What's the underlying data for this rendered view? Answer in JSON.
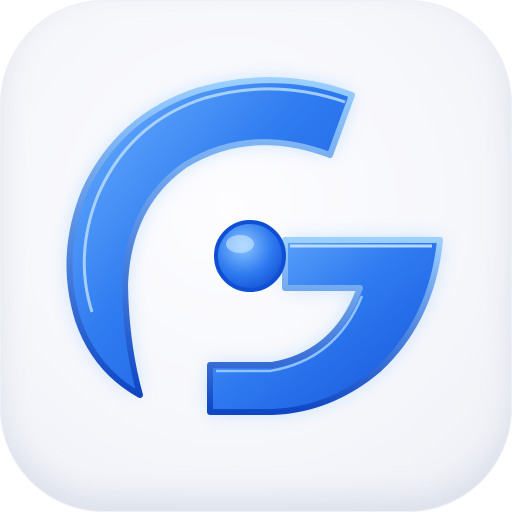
{
  "app_icon": {
    "name": "G logo",
    "glyph": "G",
    "colors": {
      "background": "#f6f7fb",
      "primary_blue": "#2f7bf0",
      "dark_blue": "#0f4fd4",
      "light_blue": "#7fc0ff",
      "glow": "#5aa8ff"
    }
  }
}
